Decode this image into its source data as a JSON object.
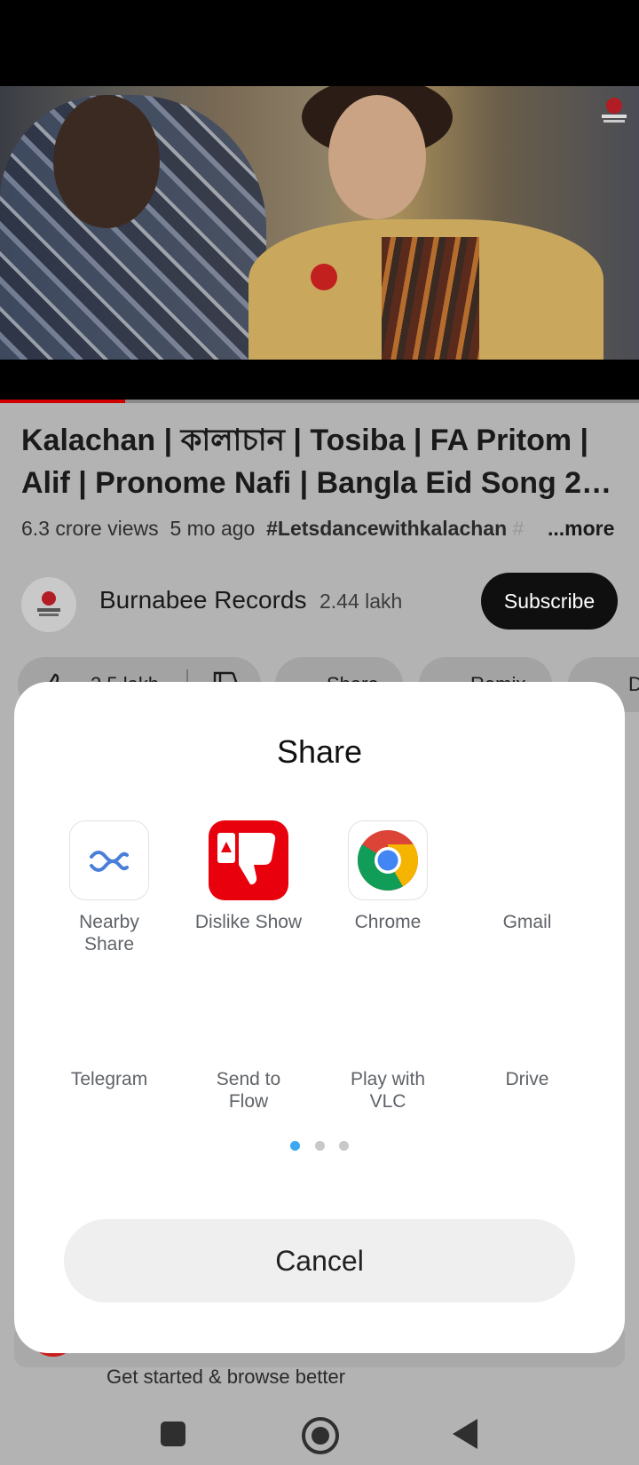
{
  "video": {
    "title": "Kalachan | কালাচান | Tosiba | FA Pritom | Alif | Pronome Nafi | Bangla Eid Song 2…",
    "views": "6.3 crore views",
    "age": "5 mo ago",
    "hashtag": "#Letsdancewithkalachan",
    "hashtag_faded": "#",
    "more_label": "...more",
    "progress": 0.196
  },
  "channel": {
    "name": "Burnabee Records",
    "subscribers": "2.44 lakh",
    "subscribe_label": "Subscribe",
    "avatar_text": "BURNABEE RECORDS",
    "watermark_text": "BURNABEE RECORDS"
  },
  "actions": {
    "like_count": "2.5 lakh",
    "share_label": "Share",
    "remix_label": "Remix",
    "download_label": "Download"
  },
  "promo": {
    "text": "Get started & browse better"
  },
  "share_sheet": {
    "title": "Share",
    "apps_row1": [
      {
        "label": "Nearby",
        "label2": "Share",
        "icon": "nearby-share-icon"
      },
      {
        "label": "Dislike Show",
        "label2": "",
        "icon": "dislike-show-icon"
      },
      {
        "label": "Chrome",
        "label2": "",
        "icon": "chrome-icon"
      },
      {
        "label": "Gmail",
        "label2": "",
        "icon": "gmail-icon"
      }
    ],
    "apps_row2": [
      {
        "label": "Telegram",
        "label2": ""
      },
      {
        "label": "Send to",
        "label2": "Flow"
      },
      {
        "label": "Play with",
        "label2": "VLC"
      },
      {
        "label": "Drive",
        "label2": ""
      }
    ],
    "page_count": 3,
    "active_page": 1,
    "cancel_label": "Cancel"
  },
  "colors": {
    "accent_red": "#d10000",
    "dot_active": "#3aa8ef",
    "scrim": "#b3b3b3"
  }
}
